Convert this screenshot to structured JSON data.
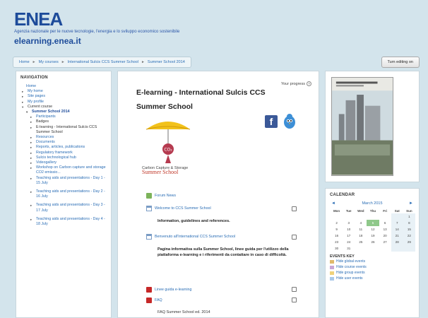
{
  "header": {
    "logo": "ENEA",
    "tagline": "Agenzia nazionale per le nuove tecnologie, l'energia e lo sviluppo economico sostenibile",
    "site_name": "elearning.enea.it"
  },
  "breadcrumb": [
    "Home",
    "My courses",
    "International Sulcis CCS Summer School",
    "Summer School 2014"
  ],
  "edit_button": "Turn editing on",
  "navigation": {
    "title": "NAVIGATION",
    "items": [
      {
        "label": "Home",
        "level": "home",
        "marker": ""
      },
      {
        "label": "My home",
        "level": "l1",
        "marker": "▸"
      },
      {
        "label": "Site pages",
        "level": "l1",
        "marker": "▸"
      },
      {
        "label": "My profile",
        "level": "l1",
        "marker": "▸"
      },
      {
        "label": "Current course",
        "level": "l1",
        "marker": "▾",
        "cur": true
      },
      {
        "label": "Summer School 2014",
        "level": "l2",
        "marker": "▾",
        "bold": true
      },
      {
        "label": "Participants",
        "level": "l3",
        "marker": "▸"
      },
      {
        "label": "Badges",
        "level": "l3",
        "marker": "▸",
        "cur": true
      },
      {
        "label": "E-learning - International Sulcis CCS Summer School",
        "level": "l3",
        "marker": "▸",
        "cur": true
      },
      {
        "label": "Resources",
        "level": "l3",
        "marker": "▸"
      },
      {
        "label": "Documents",
        "level": "l3",
        "marker": "▸"
      },
      {
        "label": "Reports, articles, publications",
        "level": "l3",
        "marker": "▸"
      },
      {
        "label": "Regulatory framework",
        "level": "l3",
        "marker": "▸"
      },
      {
        "label": "Sulcis technological hub",
        "level": "l3",
        "marker": "▸"
      },
      {
        "label": "Videogallery",
        "level": "l3",
        "marker": "▸"
      },
      {
        "label": "Workshop on Carbon capture and storage CO2 emissio...",
        "level": "l3",
        "marker": "▸"
      },
      {
        "label": "Teaching aids and presentations - Day 1 - 15 July",
        "level": "l3",
        "marker": "▸"
      },
      {
        "label": "Teaching aids and presentations - Day 2 - 16 July",
        "level": "l3",
        "marker": "▸",
        "gap": true
      },
      {
        "label": "Teaching aids and presentations - Day 3 - 17 July",
        "level": "l3",
        "marker": "▸",
        "gap": true
      },
      {
        "label": "Teaching aids and presentations - Day 4 - 18 July",
        "level": "l3",
        "marker": "▸",
        "gap": true
      }
    ]
  },
  "main": {
    "title": "E-learning - International Sulcis CCS Summer School",
    "progress_label": "Your progress",
    "ccs_logo_text": "Carbon Capture & Storage",
    "ccs_logo_big": "Summer School",
    "activities": {
      "forum": "Forum News",
      "welcome": "Welcome to CCS Summer School",
      "welcome_desc": "Information, guidelines and references.",
      "benvenuto": "Benvenuto all'International CCS Summer School",
      "benvenuto_desc": "Pagina informativa sulla Summer School, linee guida per l'utilizzo della piattaforma e-learning e i riferimenti da contattare in caso di difficoltà.",
      "linee_guida": "Linee guida e-learning",
      "faq": "FAQ",
      "faq_sub": "FAQ Summer School ed. 2014"
    }
  },
  "calendar": {
    "title": "CALENDAR",
    "month": "March 2015",
    "prev": "◄",
    "next": "►",
    "weekdays": [
      "Mon",
      "Tue",
      "Wed",
      "Thu",
      "Fri",
      "Sat",
      "Sun"
    ],
    "weeks": [
      [
        "",
        "",
        "",
        "",
        "",
        "",
        "1"
      ],
      [
        "2",
        "3",
        "4",
        "5",
        "6",
        "7",
        "8"
      ],
      [
        "9",
        "10",
        "11",
        "12",
        "13",
        "14",
        "15"
      ],
      [
        "16",
        "17",
        "18",
        "19",
        "20",
        "21",
        "22"
      ],
      [
        "23",
        "24",
        "25",
        "26",
        "27",
        "28",
        "29"
      ],
      [
        "30",
        "31",
        "",
        "",
        "",
        "",
        ""
      ]
    ],
    "today": "5",
    "events_key": "EVENTS KEY",
    "events": [
      {
        "label": "Hide global events",
        "color": "#e0b96b"
      },
      {
        "label": "Hide course events",
        "color": "#c9a6d6"
      },
      {
        "label": "Hide group events",
        "color": "#f0d27a"
      },
      {
        "label": "Hide user events",
        "color": "#a9c9e9"
      }
    ]
  },
  "colors": {
    "background": "#d3e4ec",
    "link": "#2a6db5",
    "brand": "#1d4b9a",
    "today": "#8fc88a"
  }
}
